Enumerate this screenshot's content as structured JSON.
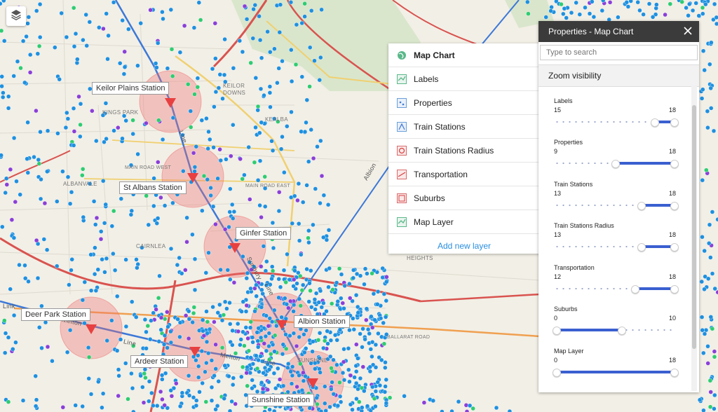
{
  "map": {
    "station_labels": [
      {
        "id": "keilor-plains",
        "text": "Keilor Plains Station"
      },
      {
        "id": "st-albans",
        "text": "St Albans Station"
      },
      {
        "id": "ginfer",
        "text": "Ginfer Station"
      },
      {
        "id": "deer-park",
        "text": "Deer Park Station"
      },
      {
        "id": "albion",
        "text": "Albion Station"
      },
      {
        "id": "ardeer",
        "text": "Ardeer Station"
      },
      {
        "id": "sunshine",
        "text": "Sunshine Station"
      }
    ],
    "place_labels": {
      "kings_park": "KINGS\nPARK",
      "keilor_downs": "KEILOR\nDOWNS",
      "kealba": "KEALBA",
      "albanvale": "ALBANVALE",
      "cairnlea": "CAIRNLEA",
      "main_road_west": "MAIN ROAD WEST",
      "main_road_east": "MAIN ROAD EAST",
      "ballarat_road": "BALLARAT ROAD",
      "heights": "HEIGHTS",
      "sunshine": "SUNSHINE",
      "albion_line": "Albion",
      "sunbury_line": "Sunbury",
      "line_text": "Line",
      "melton_line": "Melton",
      "link_text": "Link"
    },
    "colors": {
      "dot_blue": "#1e90e0",
      "dot_purple": "#8a3fd8",
      "dot_green": "#2ecc71",
      "circle": "#f07070",
      "marker": "#e84040"
    }
  },
  "layers_button": {
    "icon": "layers-icon"
  },
  "layers_menu": {
    "items": [
      {
        "label": "Map Chart",
        "icon": "globe-icon",
        "active": true
      },
      {
        "label": "Labels",
        "icon": "map-layer-icon"
      },
      {
        "label": "Properties",
        "icon": "map-layer-icon"
      },
      {
        "label": "Train Stations",
        "icon": "map-layer-icon"
      },
      {
        "label": "Train Stations Radius",
        "icon": "map-layer-icon"
      },
      {
        "label": "Transportation",
        "icon": "map-layer-icon"
      },
      {
        "label": "Suburbs",
        "icon": "map-layer-icon"
      },
      {
        "label": "Map Layer",
        "icon": "map-layer-icon"
      }
    ],
    "add_label": "Add new layer"
  },
  "properties_panel": {
    "title": "Properties - Map Chart",
    "search_placeholder": "Type to search",
    "section_title": "Zoom visibility",
    "zoom_rows": [
      {
        "name": "Labels",
        "min": "15",
        "max": "18",
        "lo": 15,
        "hi": 18
      },
      {
        "name": "Properties",
        "min": "9",
        "max": "18",
        "lo": 9,
        "hi": 18
      },
      {
        "name": "Train Stations",
        "min": "13",
        "max": "18",
        "lo": 13,
        "hi": 18
      },
      {
        "name": "Train Stations Radius",
        "min": "13",
        "max": "18",
        "lo": 13,
        "hi": 18
      },
      {
        "name": "Transportation",
        "min": "12",
        "max": "18",
        "lo": 12,
        "hi": 18
      },
      {
        "name": "Suburbs",
        "min": "0",
        "max": "10",
        "lo": 0,
        "hi": 10
      },
      {
        "name": "Map Layer",
        "min": "0",
        "max": "18",
        "lo": 0,
        "hi": 18
      }
    ],
    "zoom_scale_max": 18
  }
}
